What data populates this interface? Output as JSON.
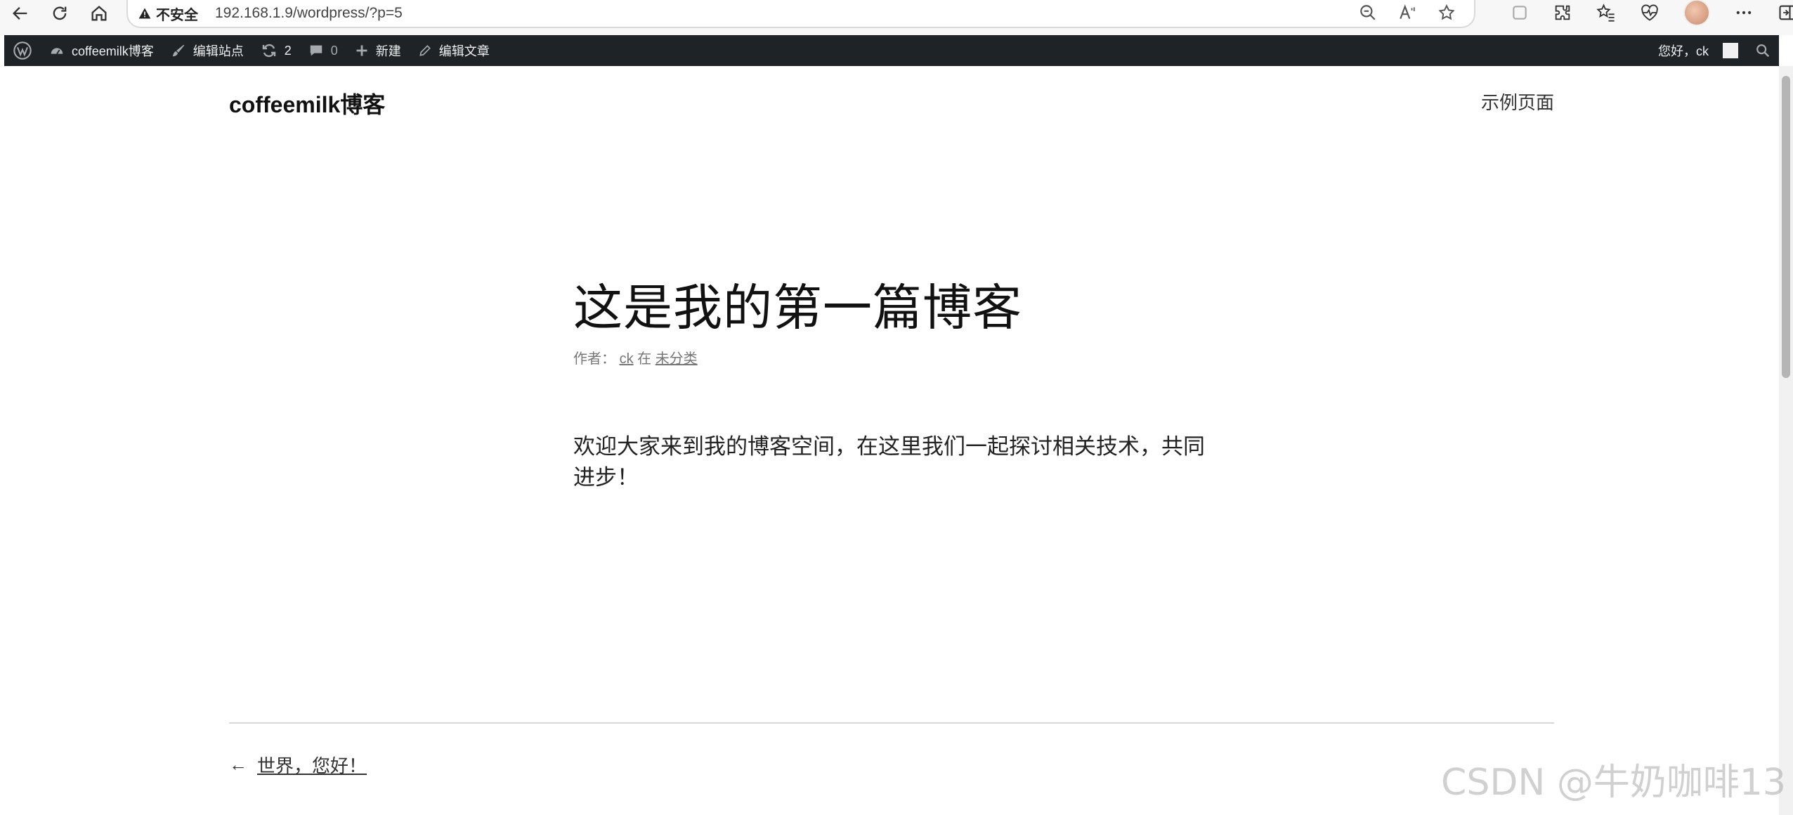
{
  "browser": {
    "security_label": "不安全",
    "url": "192.168.1.9/wordpress/?p=5"
  },
  "adminbar": {
    "site_name": "coffeemilk博客",
    "customize": "编辑站点",
    "updates_count": "2",
    "comments_count": "0",
    "new_label": "新建",
    "edit_post": "编辑文章",
    "greeting": "您好，ck"
  },
  "site": {
    "title": "coffeemilk博客",
    "nav_item": "示例页面"
  },
  "post": {
    "title": "这是我的第一篇博客",
    "meta_author_prefix": "作者：",
    "author": "ck",
    "meta_in": "在",
    "category": "未分类",
    "body_line1": "欢迎大家来到我的博客空间，在这里我们一起探讨相关技术，共同",
    "body_line2": "进步！",
    "prev_arrow": "←",
    "prev_title": "世界，您好！"
  },
  "watermark": "CSDN @牛奶咖啡13",
  "colors": {
    "adminbar_bg": "#1d2327",
    "adminbar_text": "#f0f0f1",
    "meta_gray": "#767676"
  }
}
